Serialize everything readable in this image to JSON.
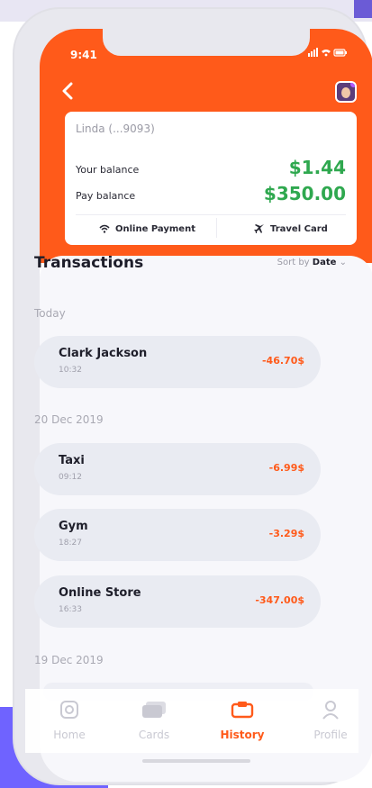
{
  "status": {
    "time": "9:41",
    "icons": "..ıl ᯤ ▭"
  },
  "account": {
    "name": "Linda (...9093)",
    "balance_label": "Your balance",
    "balance_value": "$1.44",
    "pay_label": "Pay balance",
    "pay_value": "$350.00",
    "online_payment": "Online Payment",
    "travel_card": "Travel Card"
  },
  "transactions": {
    "title": "Transactions",
    "sort_prefix": "Sort by",
    "sort_value": "Date",
    "groups": [
      {
        "date": "Today",
        "items": [
          {
            "name": "Clark Jackson",
            "time": "10:32",
            "amount": "-46.70$"
          }
        ]
      },
      {
        "date": "20 Dec 2019",
        "items": [
          {
            "name": "Taxi",
            "time": "09:12",
            "amount": "-6.99$"
          },
          {
            "name": "Gym",
            "time": "18:27",
            "amount": "-3.29$"
          },
          {
            "name": "Online Store",
            "time": "16:33",
            "amount": "-347.00$"
          }
        ]
      },
      {
        "date": "19 Dec 2019",
        "items": []
      }
    ]
  },
  "tabs": [
    {
      "label": "Home",
      "icon": "home-icon"
    },
    {
      "label": "Cards",
      "icon": "cards-icon"
    },
    {
      "label": "History",
      "icon": "history-icon",
      "active": true
    },
    {
      "label": "Profile",
      "icon": "profile-icon"
    }
  ],
  "colors": {
    "brand": "#ff5a1a",
    "positive": "#2fa84f",
    "purple": "#6f63ff"
  }
}
